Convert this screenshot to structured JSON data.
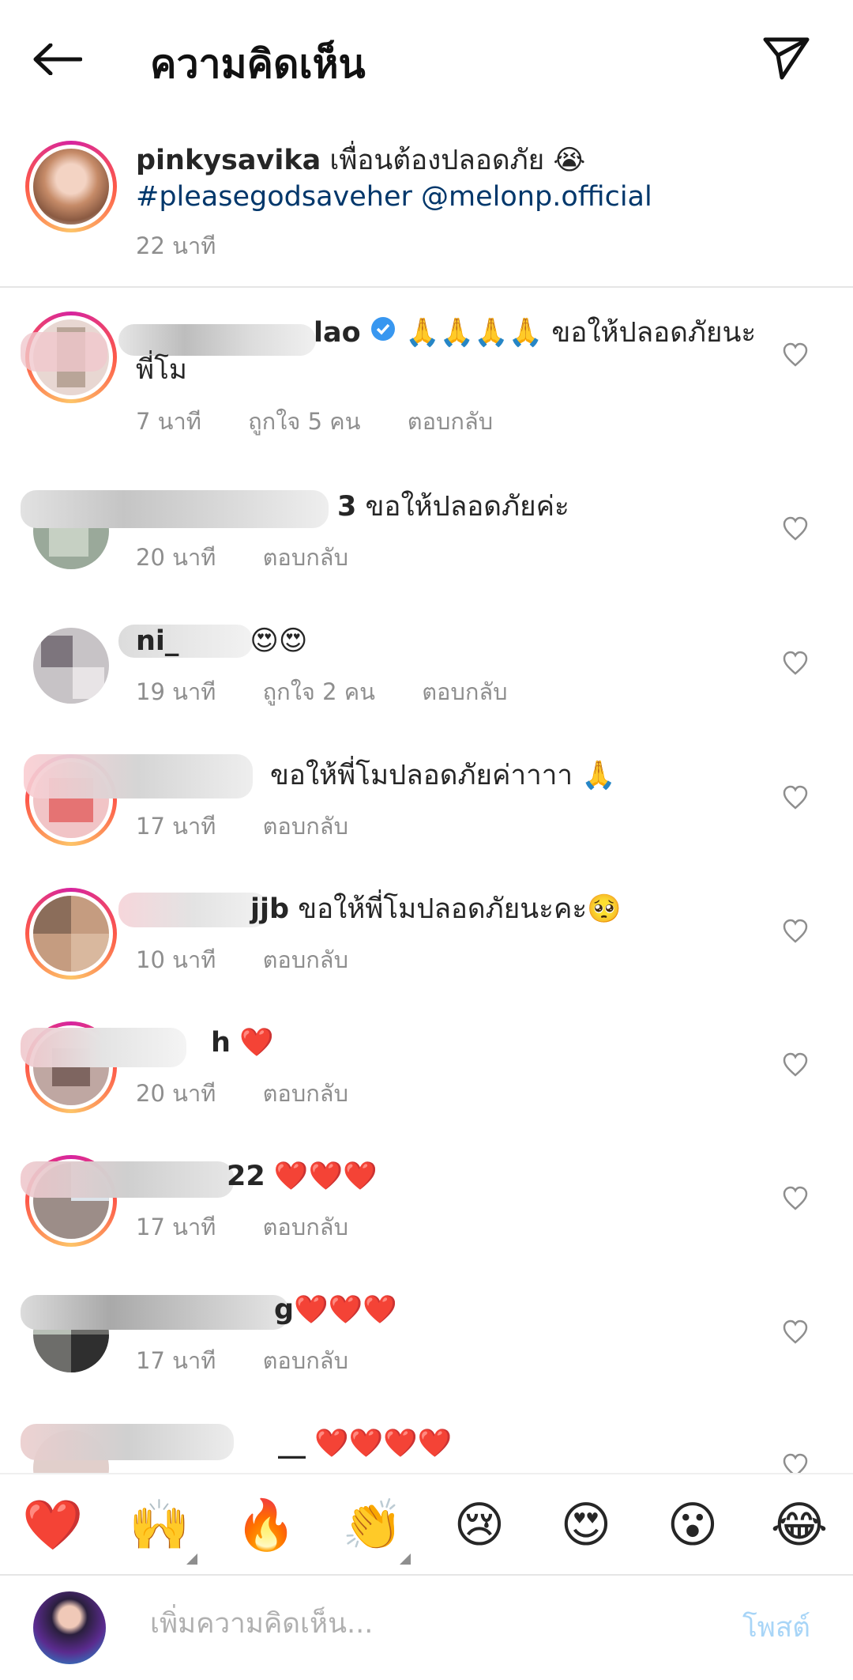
{
  "header": {
    "title": "ความคิดเห็น"
  },
  "caption": {
    "username": "pinkysavika",
    "text": "เพื่อนต้องปลอดภัย",
    "emoji": "😭",
    "hashtag": "#pleasegodsaveher",
    "mention": "@melonp.official",
    "time": "22 นาที"
  },
  "comments": [
    {
      "username": "lao",
      "text": "🙏🙏🙏🙏 ขอให้ปลอดภัยนะ",
      "text2": "พี่โม",
      "time": "7 นาที",
      "likes": "ถูกใจ 5 คน",
      "reply": "ตอบกลับ"
    },
    {
      "username": "3",
      "text": "ขอให้ปลอดภัยค่ะ",
      "time": "20 นาที",
      "reply": "ตอบกลับ"
    },
    {
      "username": "ni_",
      "text": "😍😍",
      "time": "19 นาที",
      "likes": "ถูกใจ 2 คน",
      "reply": "ตอบกลับ"
    },
    {
      "username": "",
      "text": "ขอให้พี่โมปลอดภัยค่าาาา 🙏",
      "time": "17 นาที",
      "reply": "ตอบกลับ"
    },
    {
      "username": "jjb",
      "text": "ขอให้พี่โมปลอดภัยนะคะ🥺",
      "time": "10 นาที",
      "reply": "ตอบกลับ"
    },
    {
      "username": "h",
      "text": "❤️",
      "time": "20 นาที",
      "reply": "ตอบกลับ"
    },
    {
      "username": "22",
      "text": "❤️❤️❤️",
      "time": "17 นาที",
      "reply": "ตอบกลับ"
    },
    {
      "username": "g",
      "text": "❤️❤️❤️",
      "time": "17 นาที",
      "reply": "ตอบกลับ"
    },
    {
      "username": "__",
      "text": "❤️❤️❤️❤️"
    }
  ],
  "emoji_bar": [
    "❤️",
    "🙌",
    "🔥",
    "👏",
    "😢",
    "😍",
    "😮",
    "😂"
  ],
  "composer": {
    "placeholder": "เพิ่มความคิดเห็น...",
    "post_label": "โพสต์"
  },
  "colors": {
    "link": "#00376b",
    "secondary_text": "#8e8e8e",
    "post_disabled": "#a8d5f7"
  }
}
